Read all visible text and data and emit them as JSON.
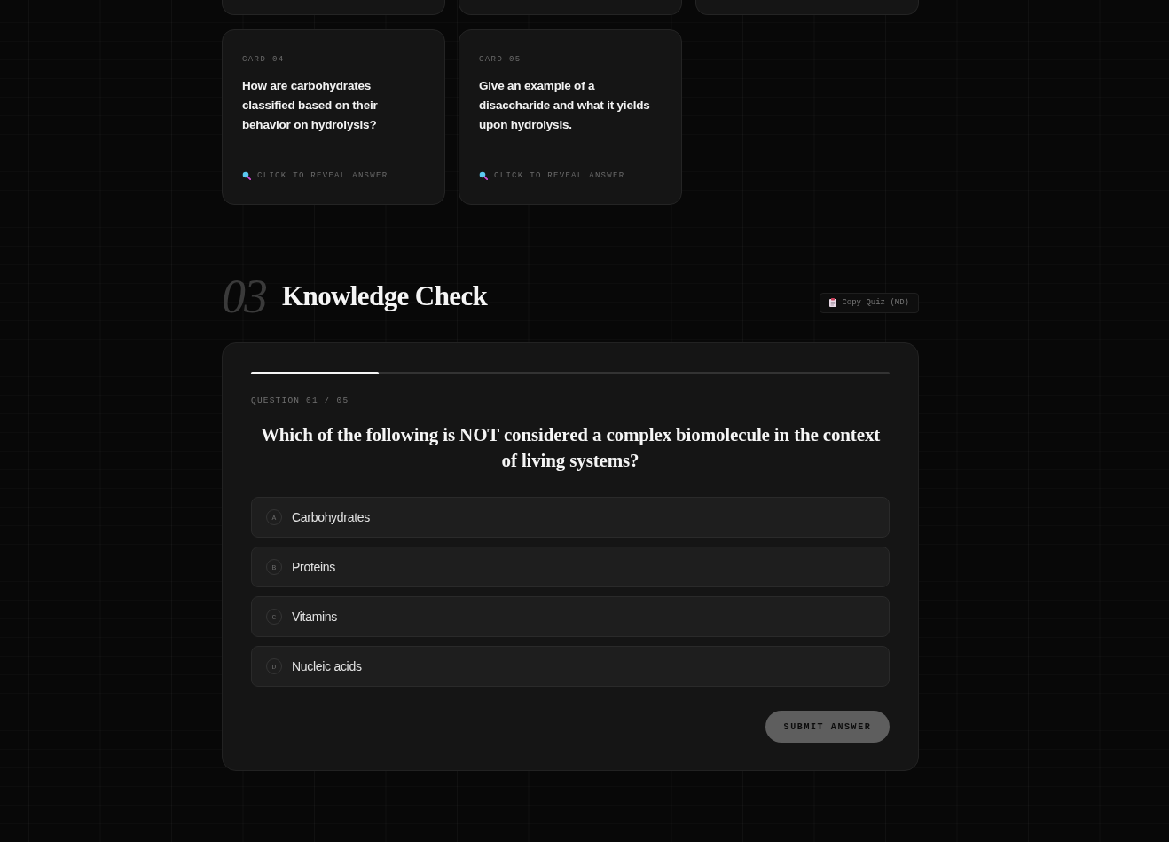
{
  "flashcards": [
    {
      "kind": "clipped"
    },
    {
      "kind": "clipped"
    },
    {
      "kind": "clipped"
    },
    {
      "kind": "full",
      "label": "CARD 04",
      "question": "How are carbohydrates classified based on their behavior on hydrolysis?",
      "hint": "CLICK TO REVEAL ANSWER"
    },
    {
      "kind": "full",
      "label": "CARD 05",
      "question": "Give an example of a disaccharide and what it yields upon hydrolysis.",
      "hint": "CLICK TO REVEAL ANSWER"
    }
  ],
  "section": {
    "number": "03",
    "title": "Knowledge Check",
    "copy_button": "Copy Quiz (MD)"
  },
  "quiz": {
    "progress": {
      "level": 0.2
    },
    "counter": "QUESTION 01 / 05",
    "question": "Which of the following is NOT considered a complex biomolecule in the context of living systems?",
    "options": [
      {
        "letter": "A",
        "text": "Carbohydrates",
        "selected": false
      },
      {
        "letter": "B",
        "text": "Proteins",
        "selected": false
      },
      {
        "letter": "C",
        "text": "Vitamins",
        "selected": false
      },
      {
        "letter": "D",
        "text": "Nucleic acids",
        "selected": false
      }
    ],
    "submit": {
      "label": "SUBMIT ANSWER",
      "disabled": true
    }
  }
}
